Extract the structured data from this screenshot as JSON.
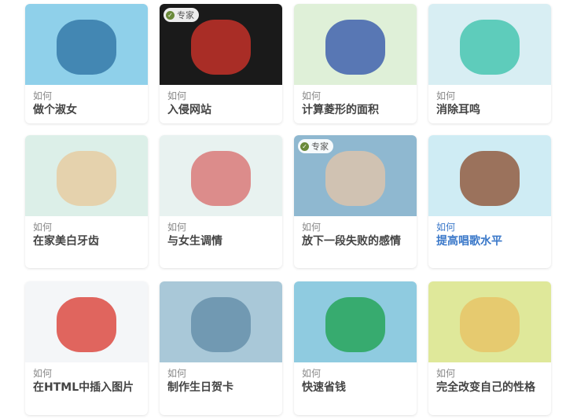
{
  "prefix": "如何",
  "expert_label": "专家",
  "accent_color": "#3a78c9",
  "cards": [
    {
      "title": "做个淑女",
      "bg": "#8fd0ea",
      "fg": "#2a6fa0"
    },
    {
      "title": "入侵网站",
      "bg": "#1a1a1a",
      "fg": "#d9342b",
      "expert": true
    },
    {
      "title": "计算菱形的面积",
      "bg": "#dff0d8",
      "fg": "#2b4fa8"
    },
    {
      "title": "消除耳鸣",
      "bg": "#d8eef3",
      "fg": "#35c0a8"
    },
    {
      "title": "在家美白牙齿",
      "bg": "#dcefe8",
      "fg": "#e8c89a"
    },
    {
      "title": "与女生调情",
      "bg": "#e8f2f0",
      "fg": "#d86a6a"
    },
    {
      "title": "放下一段失败的感情",
      "bg": "#8fb8d0",
      "fg": "#e6c6a8",
      "expert": true
    },
    {
      "title": "提高唱歌水平",
      "bg": "#cfecf4",
      "fg": "#8a4a2a",
      "hover": true
    },
    {
      "title": "在HTML中插入图片",
      "bg": "#f4f6f8",
      "fg": "#d9342b"
    },
    {
      "title": "制作生日贺卡",
      "bg": "#a9c8d8",
      "fg": "#5f8aa6"
    },
    {
      "title": "快速省钱",
      "bg": "#8fcbe0",
      "fg": "#1aa04a"
    },
    {
      "title": "完全改变自己的性格",
      "bg": "#dfe89a",
      "fg": "#e8c060"
    }
  ]
}
